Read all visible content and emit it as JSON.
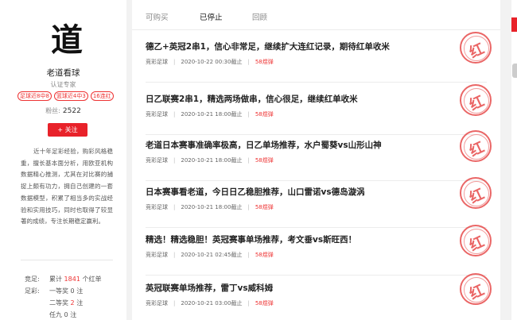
{
  "profile": {
    "logo_char": "道",
    "name": "老道看球",
    "role": "认证专家",
    "badges": [
      "足球近8中8",
      "篮球近4中3",
      "16连红"
    ],
    "fans_label": "粉丝:",
    "fans_count": "2522",
    "follow_label": "+ 关注",
    "bio": "近十年足彩经验，购彩风格稳重，擅长基本面分析，用欧亚机构数据精心推测，尤其在对比赛的捕捉上颇有功力，拥自己创建的一套数据模型，积累了相当多的实战经验和实用技巧，同时也取得了较显著的成绩，专注长期稳定赢利。",
    "stats": {
      "jingcai_label": "竞足:",
      "jingcai_text_pre": "累计",
      "jingcai_count": "1841",
      "jingcai_text_post": "个红单",
      "zucai_label": "足彩:",
      "first_pre": "一等奖",
      "first_count": "0",
      "first_post": "注",
      "second_pre": "二等奖",
      "second_count": "2",
      "second_post": "注",
      "ren9_pre": "任九",
      "ren9_count": "0",
      "ren9_post": "注"
    }
  },
  "tabs": [
    {
      "label": "可购买",
      "active": false
    },
    {
      "label": "已停止",
      "active": true
    },
    {
      "label": "回顾",
      "active": false
    }
  ],
  "articles": [
    {
      "title": "德乙+英冠2串1，信心非常足，继续扩大连红记录，期待红单收米",
      "category": "竞彩足球",
      "time": "2020-10-22 00:30截止",
      "price": "58煜弹"
    },
    {
      "title": "日乙联赛2串1，精选两场做串，信心很足，继续红单收米",
      "category": "竞彩足球",
      "time": "2020-10-21 18:00截止",
      "price": "58煜弹"
    },
    {
      "title": "老道日本赛事准确率极高，日乙单场推荐，水户蜀葵vs山形山神",
      "category": "竞彩足球",
      "time": "2020-10-21 18:00截止",
      "price": "58煜弹"
    },
    {
      "title": "日本赛事看老道，今日日乙稳胆推荐，山口雷诺vs德岛漩涡",
      "category": "竞彩足球",
      "time": "2020-10-21 18:00截止",
      "price": "58煜弹"
    },
    {
      "title": "精选！精选稳胆！英冠赛事单场推荐，考文垂vs斯旺西！",
      "category": "竞彩足球",
      "time": "2020-10-21 02:45截止",
      "price": "58煜弹"
    },
    {
      "title": "英冠联赛单场推荐，雷丁vs威科姆",
      "category": "竞彩足球",
      "time": "2020-10-21 03:00截止",
      "price": "58煜弹"
    }
  ],
  "stamp_char": "红",
  "colors": {
    "accent": "#e8222a",
    "stamp": "#e74c4c"
  }
}
